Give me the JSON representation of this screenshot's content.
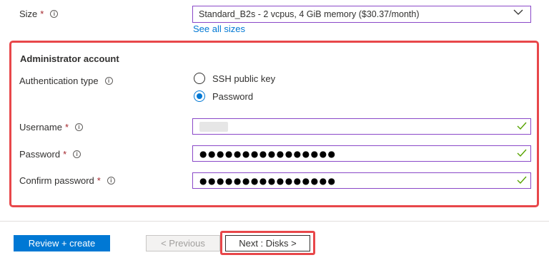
{
  "size": {
    "label": "Size",
    "required_mark": "*",
    "info_glyph": "i",
    "selected": "Standard_B2s - 2 vcpus, 4 GiB memory ($30.37/month)",
    "see_all_link": "See all sizes"
  },
  "admin": {
    "heading": "Administrator account",
    "auth": {
      "label": "Authentication type",
      "info_glyph": "i",
      "options": [
        "SSH public key",
        "Password"
      ],
      "selected": "Password"
    },
    "username": {
      "label": "Username",
      "required_mark": "*",
      "info_glyph": "i"
    },
    "password": {
      "label": "Password",
      "required_mark": "*",
      "info_glyph": "i",
      "value": "●●●●●●●●●●●●●●●●"
    },
    "confirm": {
      "label": "Confirm password",
      "required_mark": "*",
      "info_glyph": "i",
      "value": "●●●●●●●●●●●●●●●●"
    }
  },
  "footer": {
    "review_create": "Review + create",
    "previous": "< Previous",
    "next": "Next : Disks >"
  },
  "colors": {
    "accent": "#0078d4",
    "highlight": "#e8474a",
    "valid": "#57a300",
    "focus_border": "#8a48c8"
  }
}
